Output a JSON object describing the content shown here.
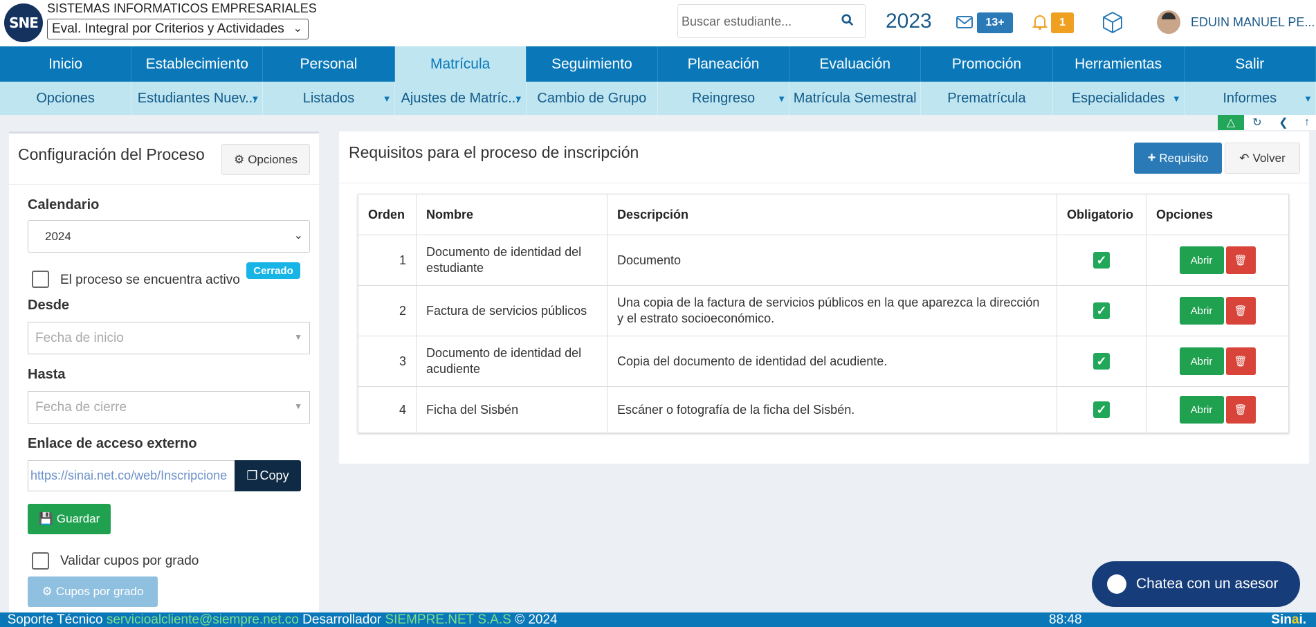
{
  "header": {
    "logo_text": "SNE",
    "company": "SISTEMAS INFORMATICOS EMPRESARIALES",
    "institution": "Eval. Integral por Criterios y Actividades",
    "search_placeholder": "Buscar estudiante...",
    "year": "2023",
    "messages_count": "13+",
    "notifications_count": "1",
    "username": "EDUIN MANUEL PE..."
  },
  "main_nav": [
    {
      "label": "Inicio"
    },
    {
      "label": "Establecimiento"
    },
    {
      "label": "Personal"
    },
    {
      "label": "Matrícula",
      "active": true
    },
    {
      "label": "Seguimiento"
    },
    {
      "label": "Planeación"
    },
    {
      "label": "Evaluación"
    },
    {
      "label": "Promoción"
    },
    {
      "label": "Herramientas"
    },
    {
      "label": "Salir"
    }
  ],
  "sub_nav": [
    {
      "label": "Opciones"
    },
    {
      "label": "Estudiantes Nuev...",
      "dropdown": true
    },
    {
      "label": "Listados",
      "dropdown": true
    },
    {
      "label": "Ajustes de Matríc...",
      "dropdown": true
    },
    {
      "label": "Cambio de Grupo"
    },
    {
      "label": "Reingreso",
      "dropdown": true
    },
    {
      "label": "Matrícula Semestral"
    },
    {
      "label": "Prematrícula"
    },
    {
      "label": "Especialidades",
      "dropdown": true
    },
    {
      "label": "Informes",
      "dropdown": true
    }
  ],
  "config": {
    "title": "Configuración del Proceso",
    "options_label": "Opciones",
    "calendar_label": "Calendario",
    "calendar_value": "2024",
    "active_label": "El proceso se encuentra activo",
    "active_checked": false,
    "status_badge": "Cerrado",
    "from_label": "Desde",
    "from_placeholder": "Fecha de inicio",
    "to_label": "Hasta",
    "to_placeholder": "Fecha de cierre",
    "link_label": "Enlace de acceso externo",
    "link_value": "https://sinai.net.co/web/Inscripcione",
    "copy_label": "Copy",
    "save_label": "Guardar",
    "validate_label": "Validar cupos por grado",
    "validate_checked": false,
    "quota_label": "Cupos por grado"
  },
  "requirements": {
    "title": "Requisitos para el proceso de inscripción",
    "add_label": "Requisito",
    "back_label": "Volver",
    "columns": [
      "Orden",
      "Nombre",
      "Descripción",
      "Obligatorio",
      "Opciones"
    ],
    "open_label": "Abrir",
    "rows": [
      {
        "order": "1",
        "name": "Documento de identidad del estudiante",
        "description": "Documento",
        "mandatory": true
      },
      {
        "order": "2",
        "name": "Factura de servicios públicos",
        "description": "Una copia de la factura de servicios públicos en la que aparezca la dirección y el estrato socioeconómico.",
        "mandatory": true
      },
      {
        "order": "3",
        "name": "Documento de identidad del acudiente",
        "description": "Copia del documento de identidad del acudiente.",
        "mandatory": true
      },
      {
        "order": "4",
        "name": "Ficha del Sisbén",
        "description": "Escáner o fotografía de la ficha del Sisbén.",
        "mandatory": true
      }
    ]
  },
  "chat": {
    "label": "Chatea con un asesor"
  },
  "footer": {
    "support_label": "Soporte Técnico",
    "support_email": "servicioalcliente@siempre.net.co",
    "developer_label": "Desarrollador",
    "developer": "SIEMPRE.NET S.A.S",
    "copyright": "© 2024",
    "timer": "88:48",
    "brand": "Sin",
    "brand_accent": "a",
    "brand_end": "i."
  },
  "colors": {
    "primary": "#0a78b8",
    "subnav": "#bfe5f1",
    "success": "#1fa150",
    "danger": "#d9443a",
    "info_badge": "#17b4e6"
  }
}
